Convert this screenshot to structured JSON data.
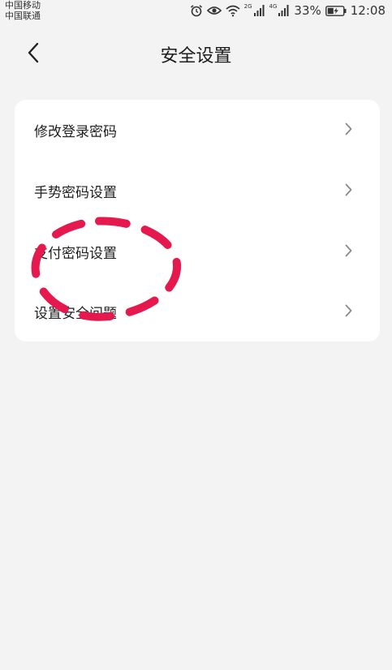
{
  "status_bar": {
    "carrier_1": "中国移动",
    "carrier_2": "中国联通",
    "net_2g": "2G",
    "net_4g": "4G",
    "battery": "33%",
    "time": "12:08"
  },
  "header": {
    "title": "安全设置"
  },
  "settings": {
    "items": [
      {
        "label": "修改登录密码"
      },
      {
        "label": "手势密码设置"
      },
      {
        "label": "支付密码设置"
      },
      {
        "label": "设置安全问题"
      }
    ]
  },
  "colors": {
    "background": "#f3f3f3",
    "card": "#ffffff",
    "annotation": "#e5194d"
  },
  "icons": [
    "alarm-icon",
    "eye-icon",
    "wifi-icon",
    "signal-icon",
    "battery-icon",
    "back-arrow-icon",
    "chevron-right-icon"
  ]
}
